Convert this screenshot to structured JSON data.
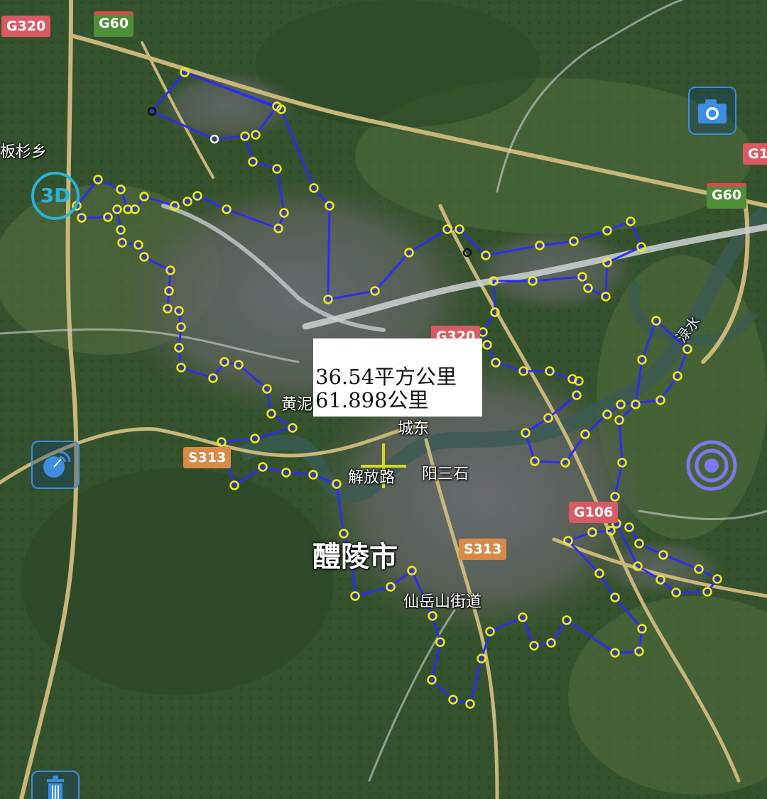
{
  "map": {
    "measurement": {
      "area": "36.54平方公里",
      "perimeter": "61.898公里"
    },
    "road_shields": [
      {
        "id": "g320-nw",
        "label": "G320",
        "kind": "national"
      },
      {
        "id": "g60-n",
        "label": "G60",
        "kind": "expressway"
      },
      {
        "id": "g60-e",
        "label": "G60",
        "kind": "expressway"
      },
      {
        "id": "g1-e",
        "label": "G1",
        "kind": "national"
      },
      {
        "id": "g320-c",
        "label": "G320",
        "kind": "national"
      },
      {
        "id": "s313-w",
        "label": "S313",
        "kind": "provincial"
      },
      {
        "id": "g106",
        "label": "G106",
        "kind": "national"
      },
      {
        "id": "s313-s",
        "label": "S313",
        "kind": "provincial"
      }
    ],
    "place_labels": [
      {
        "id": "banshan",
        "label": "板杉乡"
      },
      {
        "id": "huangni",
        "label": "黄泥"
      },
      {
        "id": "chengdong",
        "label": "城东"
      },
      {
        "id": "jiefanglu",
        "label": "解放路"
      },
      {
        "id": "yangsanshi",
        "label": "阳三石"
      },
      {
        "id": "liling",
        "label": "醴陵市"
      },
      {
        "id": "xianyue",
        "label": "仙岳山街道"
      },
      {
        "id": "lushui",
        "label": "渌水"
      }
    ],
    "tools": {
      "camera_icon": "camera-icon",
      "view_3d_label": "3D",
      "layers_icon": "satellite-dish-icon",
      "location_icon": "target-icon",
      "delete_icon": "trash-icon"
    },
    "colors": {
      "polygon_stroke": "#2d2df0",
      "vertex_marker": "#f2ec1a",
      "national_road": "#d95a63",
      "expressway": "#4e8f3a",
      "provincial_road": "#d98a47",
      "tool_accent": "#3d8de0"
    }
  }
}
